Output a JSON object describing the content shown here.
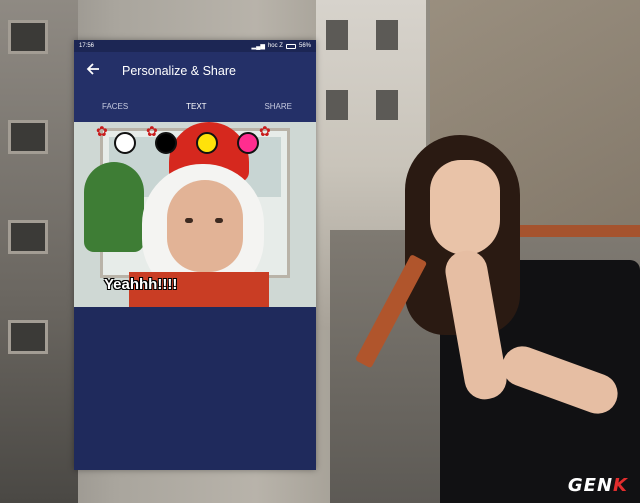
{
  "status_bar": {
    "time": "17:56",
    "carrier": "hoc Z",
    "battery": "56%"
  },
  "app_bar": {
    "title": "Personalize & Share",
    "back_icon": "back-arrow-icon"
  },
  "tabs": [
    {
      "label": "FACES",
      "active": false
    },
    {
      "label": "TEXT",
      "active": true
    },
    {
      "label": "SHARE",
      "active": false
    }
  ],
  "text_colors": [
    "#ffffff",
    "#000000",
    "#ffe20a",
    "#ff2d8f"
  ],
  "caption_text": "Yeahhh!!!!",
  "watermark": {
    "main": "GEN",
    "accent": "K"
  },
  "colors": {
    "app_primary": "#243068",
    "app_background": "#1f2a5c",
    "watermark_accent": "#e22d2d"
  }
}
